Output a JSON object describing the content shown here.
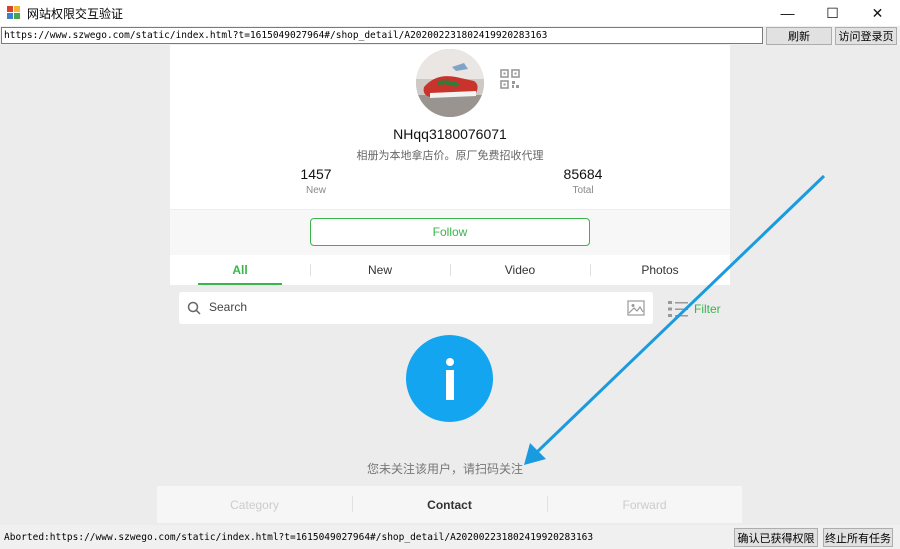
{
  "window": {
    "title": "网站权限交互验证",
    "minimize": "—",
    "maximize": "☐",
    "close": "✕"
  },
  "toolbar": {
    "url": "https://www.szwego.com/static/index.html?t=1615049027964#/shop_detail/A202002231802419920283163",
    "refresh_label": "刷新",
    "login_page_label": "访问登录页"
  },
  "profile": {
    "name": "NHqq3180076071",
    "description": "相册为本地拿店价。原厂免费招收代理",
    "stats": [
      {
        "value": "1457",
        "label": "New"
      },
      {
        "value": "85684",
        "label": "Total"
      }
    ],
    "follow_label": "Follow"
  },
  "tabs": [
    {
      "label": "All",
      "active": true
    },
    {
      "label": "New",
      "active": false
    },
    {
      "label": "Video",
      "active": false
    },
    {
      "label": "Photos",
      "active": false
    }
  ],
  "search": {
    "placeholder": "Search",
    "filter_label": "Filter"
  },
  "notice": "您未关注该用户，请扫码关注",
  "bottom_tabs": [
    {
      "label": "Category",
      "active": false
    },
    {
      "label": "Contact",
      "active": true
    },
    {
      "label": "Forward",
      "active": false
    }
  ],
  "status": {
    "text": "Aborted:https://www.szwego.com/static/index.html?t=1615049027964#/shop_detail/A202002231802419920283163",
    "confirm_label": "确认已获得权限",
    "stop_label": "终止所有任务"
  },
  "colors": {
    "accent_green": "#3ab54a",
    "info_blue": "#13a5ef",
    "arrow_blue": "#1a9be0"
  },
  "icons": {
    "app": "app-icon",
    "qr": "qr-code-icon",
    "search": "search-icon",
    "image": "image-icon",
    "filter": "filter-list-icon",
    "info": "info-icon",
    "arrow": "arrow-annotation"
  }
}
